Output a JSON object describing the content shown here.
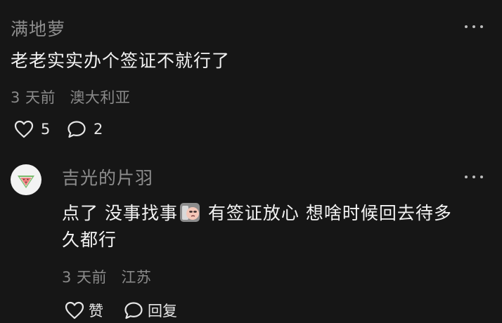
{
  "comment": {
    "username": "满地萝",
    "text": "老老实实办个签证不就行了",
    "time": "3 天前",
    "location": "澳大利亚",
    "likes": "5",
    "replies": "2"
  },
  "reply": {
    "username": "吉光的片羽",
    "text_part1": "点了 没事找事",
    "text_part2": " 有签证放心 想啥时候回去待多",
    "text_line2": "久都行",
    "time": "3 天前",
    "location": "江苏",
    "like_label": "赞",
    "reply_label": "回复"
  },
  "icons": {
    "like": "heart-outline-icon",
    "comment": "speech-bubble-icon",
    "more": "more-dots-icon",
    "emoji": "side-eye-emoji-sticker",
    "avatar": "watermelon-avatar"
  },
  "colors": {
    "background": "#161616",
    "primary_text": "#f2f2f2",
    "secondary_text": "#8e8e8e"
  }
}
